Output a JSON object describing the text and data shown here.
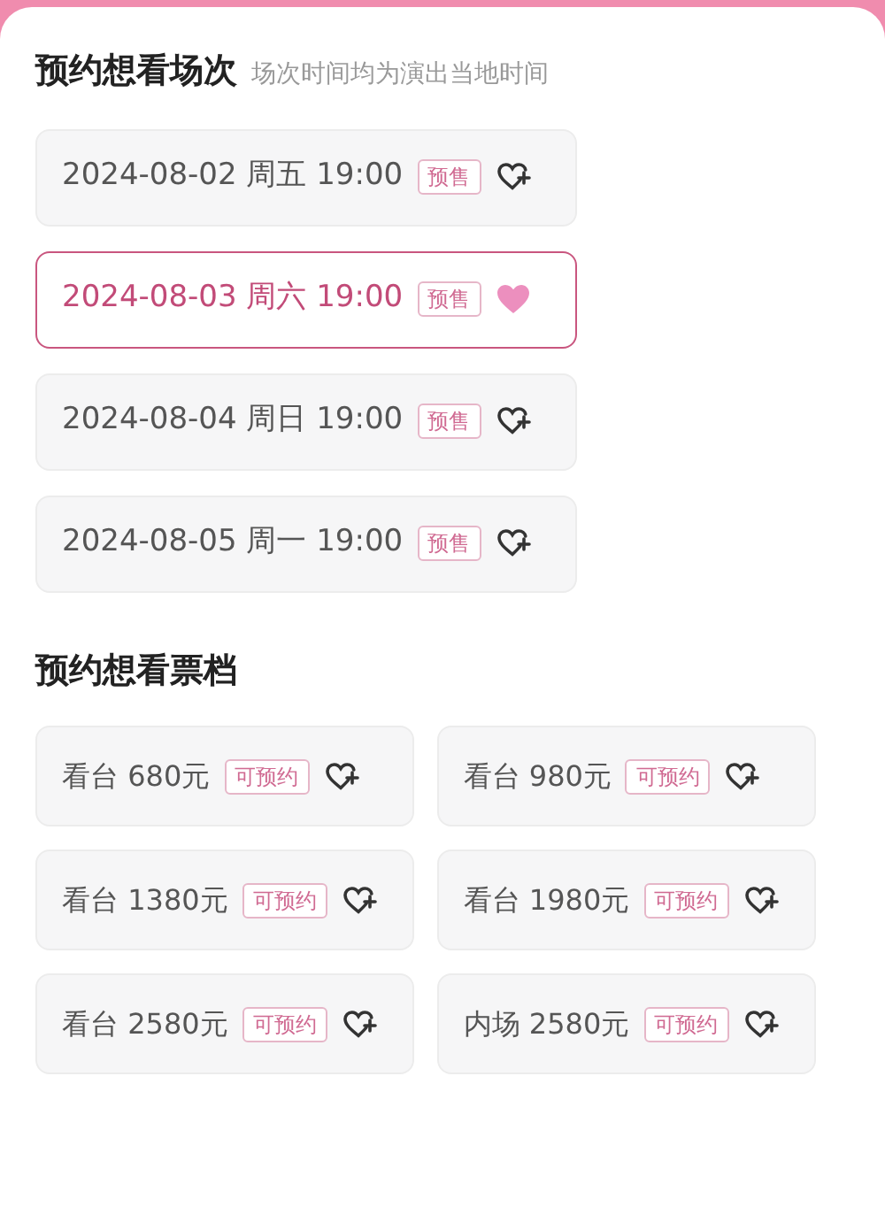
{
  "sessions_section": {
    "title": "预约想看场次",
    "note": "场次时间均为演出当地时间"
  },
  "sessions": [
    {
      "label": "2024-08-02 周五 19:00",
      "badge": "预售",
      "selected": false
    },
    {
      "label": "2024-08-03 周六 19:00",
      "badge": "预售",
      "selected": true
    },
    {
      "label": "2024-08-04 周日 19:00",
      "badge": "预售",
      "selected": false
    },
    {
      "label": "2024-08-05 周一 19:00",
      "badge": "预售",
      "selected": false
    }
  ],
  "tickets_section": {
    "title": "预约想看票档"
  },
  "tickets": [
    {
      "label": "看台 680元",
      "badge": "可预约",
      "selected": false
    },
    {
      "label": "看台 980元",
      "badge": "可预约",
      "selected": false
    },
    {
      "label": "看台 1380元",
      "badge": "可预约",
      "selected": false
    },
    {
      "label": "看台 1980元",
      "badge": "可预约",
      "selected": false
    },
    {
      "label": "看台 2580元",
      "badge": "可预约",
      "selected": false
    },
    {
      "label": "内场 2580元",
      "badge": "可预约",
      "selected": false
    }
  ]
}
